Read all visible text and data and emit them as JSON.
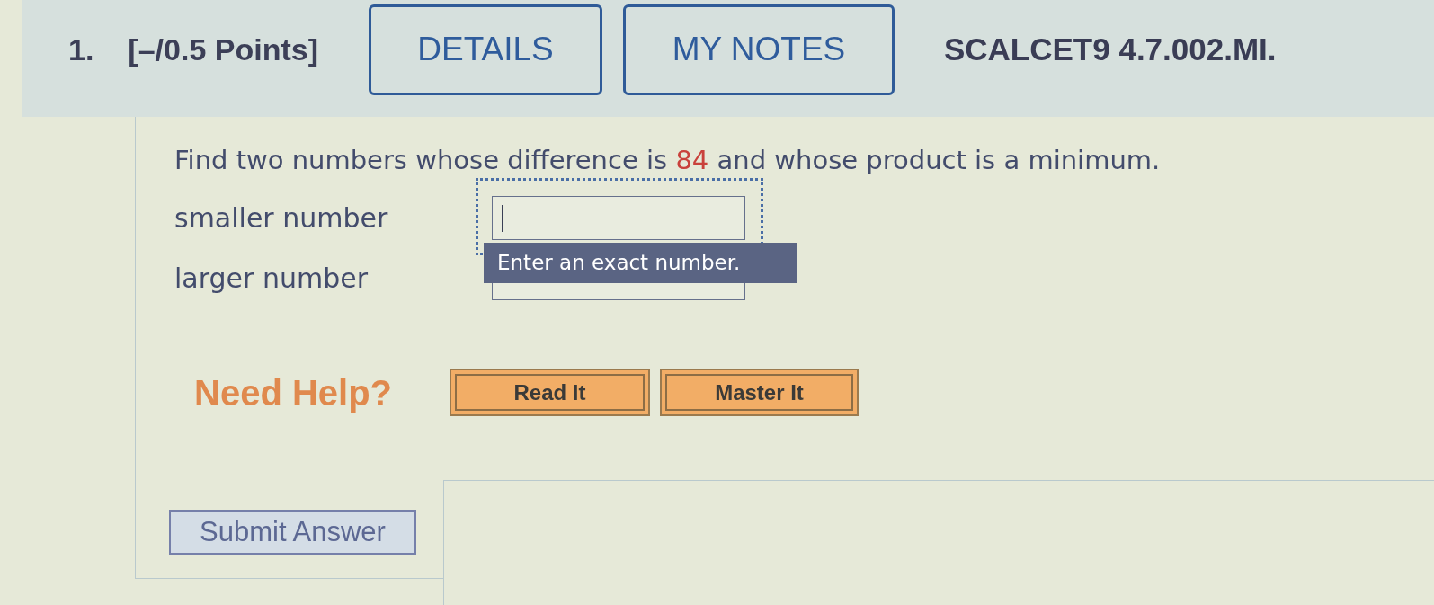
{
  "header": {
    "number": "1.",
    "points": "[–/0.5 Points]",
    "buttons": [
      "DETAILS",
      "MY NOTES"
    ],
    "problem_id": "SCALCET9 4.7.002.MI."
  },
  "question": {
    "prompt_parts": [
      {
        "text": "Find two numbers whose difference is",
        "kind": "plain"
      },
      {
        "text": "84",
        "kind": "given"
      },
      {
        "text": "and whose product is a minimum.",
        "kind": "plain"
      }
    ]
  },
  "answers": [
    {
      "label": "smaller number",
      "focused": true
    },
    {
      "label": "larger number",
      "focused": false
    }
  ],
  "tooltip": "Enter an exact number.",
  "help": {
    "label": "Need Help?",
    "buttons": [
      "Read It",
      "Master It"
    ]
  },
  "submit": "Submit Answer"
}
